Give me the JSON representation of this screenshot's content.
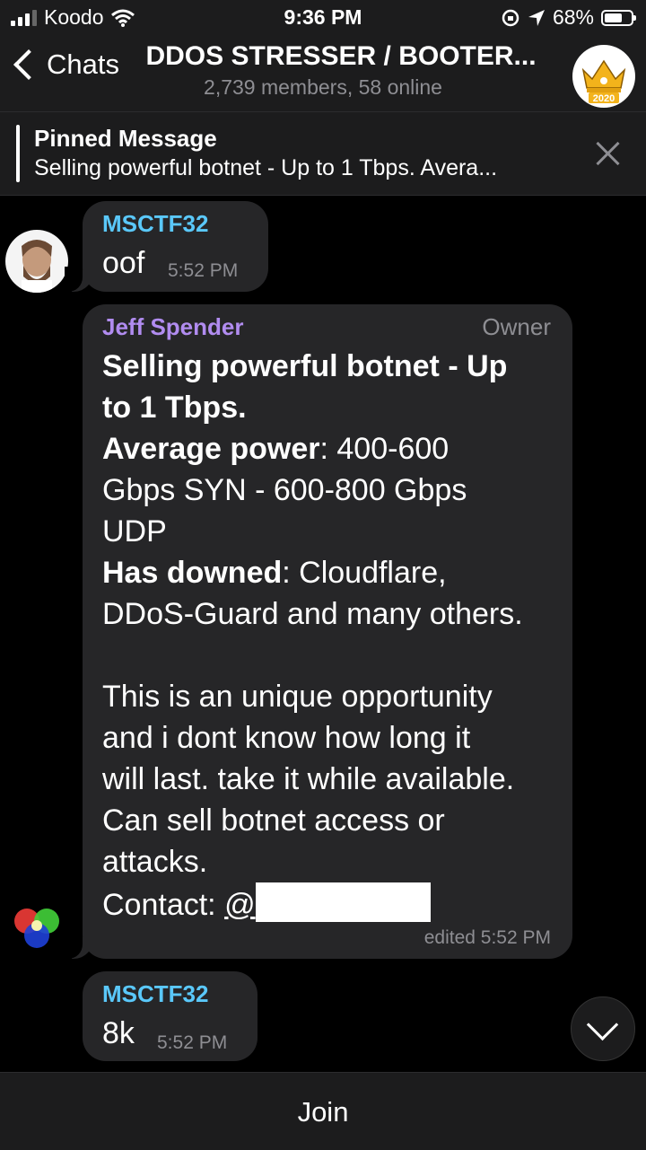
{
  "status_bar": {
    "carrier": "Koodo",
    "time": "9:36 PM",
    "battery": "68%",
    "battery_level": 0.68
  },
  "header": {
    "back_label": "Chats",
    "title": "DDOS STRESSER / BOOTER...",
    "subtitle": "2,739 members, 58 online",
    "avatar_badge": "2020"
  },
  "pinned": {
    "title": "Pinned Message",
    "text": "Selling powerful botnet - Up to 1 Tbps. Avera..."
  },
  "messages": [
    {
      "sender": "MSCTF32",
      "text": "oof",
      "time": "5:52 PM"
    },
    {
      "sender": "Jeff Spender",
      "role": "Owner",
      "line1": "Selling powerful botnet - Up",
      "line2": "to 1 Tbps.",
      "avg_label": "Average power",
      "avg_rest": ": 400-600",
      "line4": "Gbps SYN - 600-800 Gbps",
      "line5": "UDP",
      "downed_label": "Has downed",
      "downed_rest": ": Cloudflare,",
      "line7": "DDoS-Guard and many others.",
      "line8": "This is an unique opportunity",
      "line9": "and i dont know how long it",
      "line10": "will last. take it while available.",
      "line11": "Can sell botnet access or",
      "line12": "attacks.",
      "contact_label": "Contact: ",
      "contact_handle": "@",
      "time": "edited 5:52 PM"
    },
    {
      "sender": "MSCTF32",
      "text": "8k",
      "time": "5:52 PM"
    }
  ],
  "footer": {
    "join_label": "Join"
  },
  "colors": {
    "sender_blue": "#5ac8fa",
    "sender_purple": "#b18cf0",
    "bubble": "#262628"
  }
}
